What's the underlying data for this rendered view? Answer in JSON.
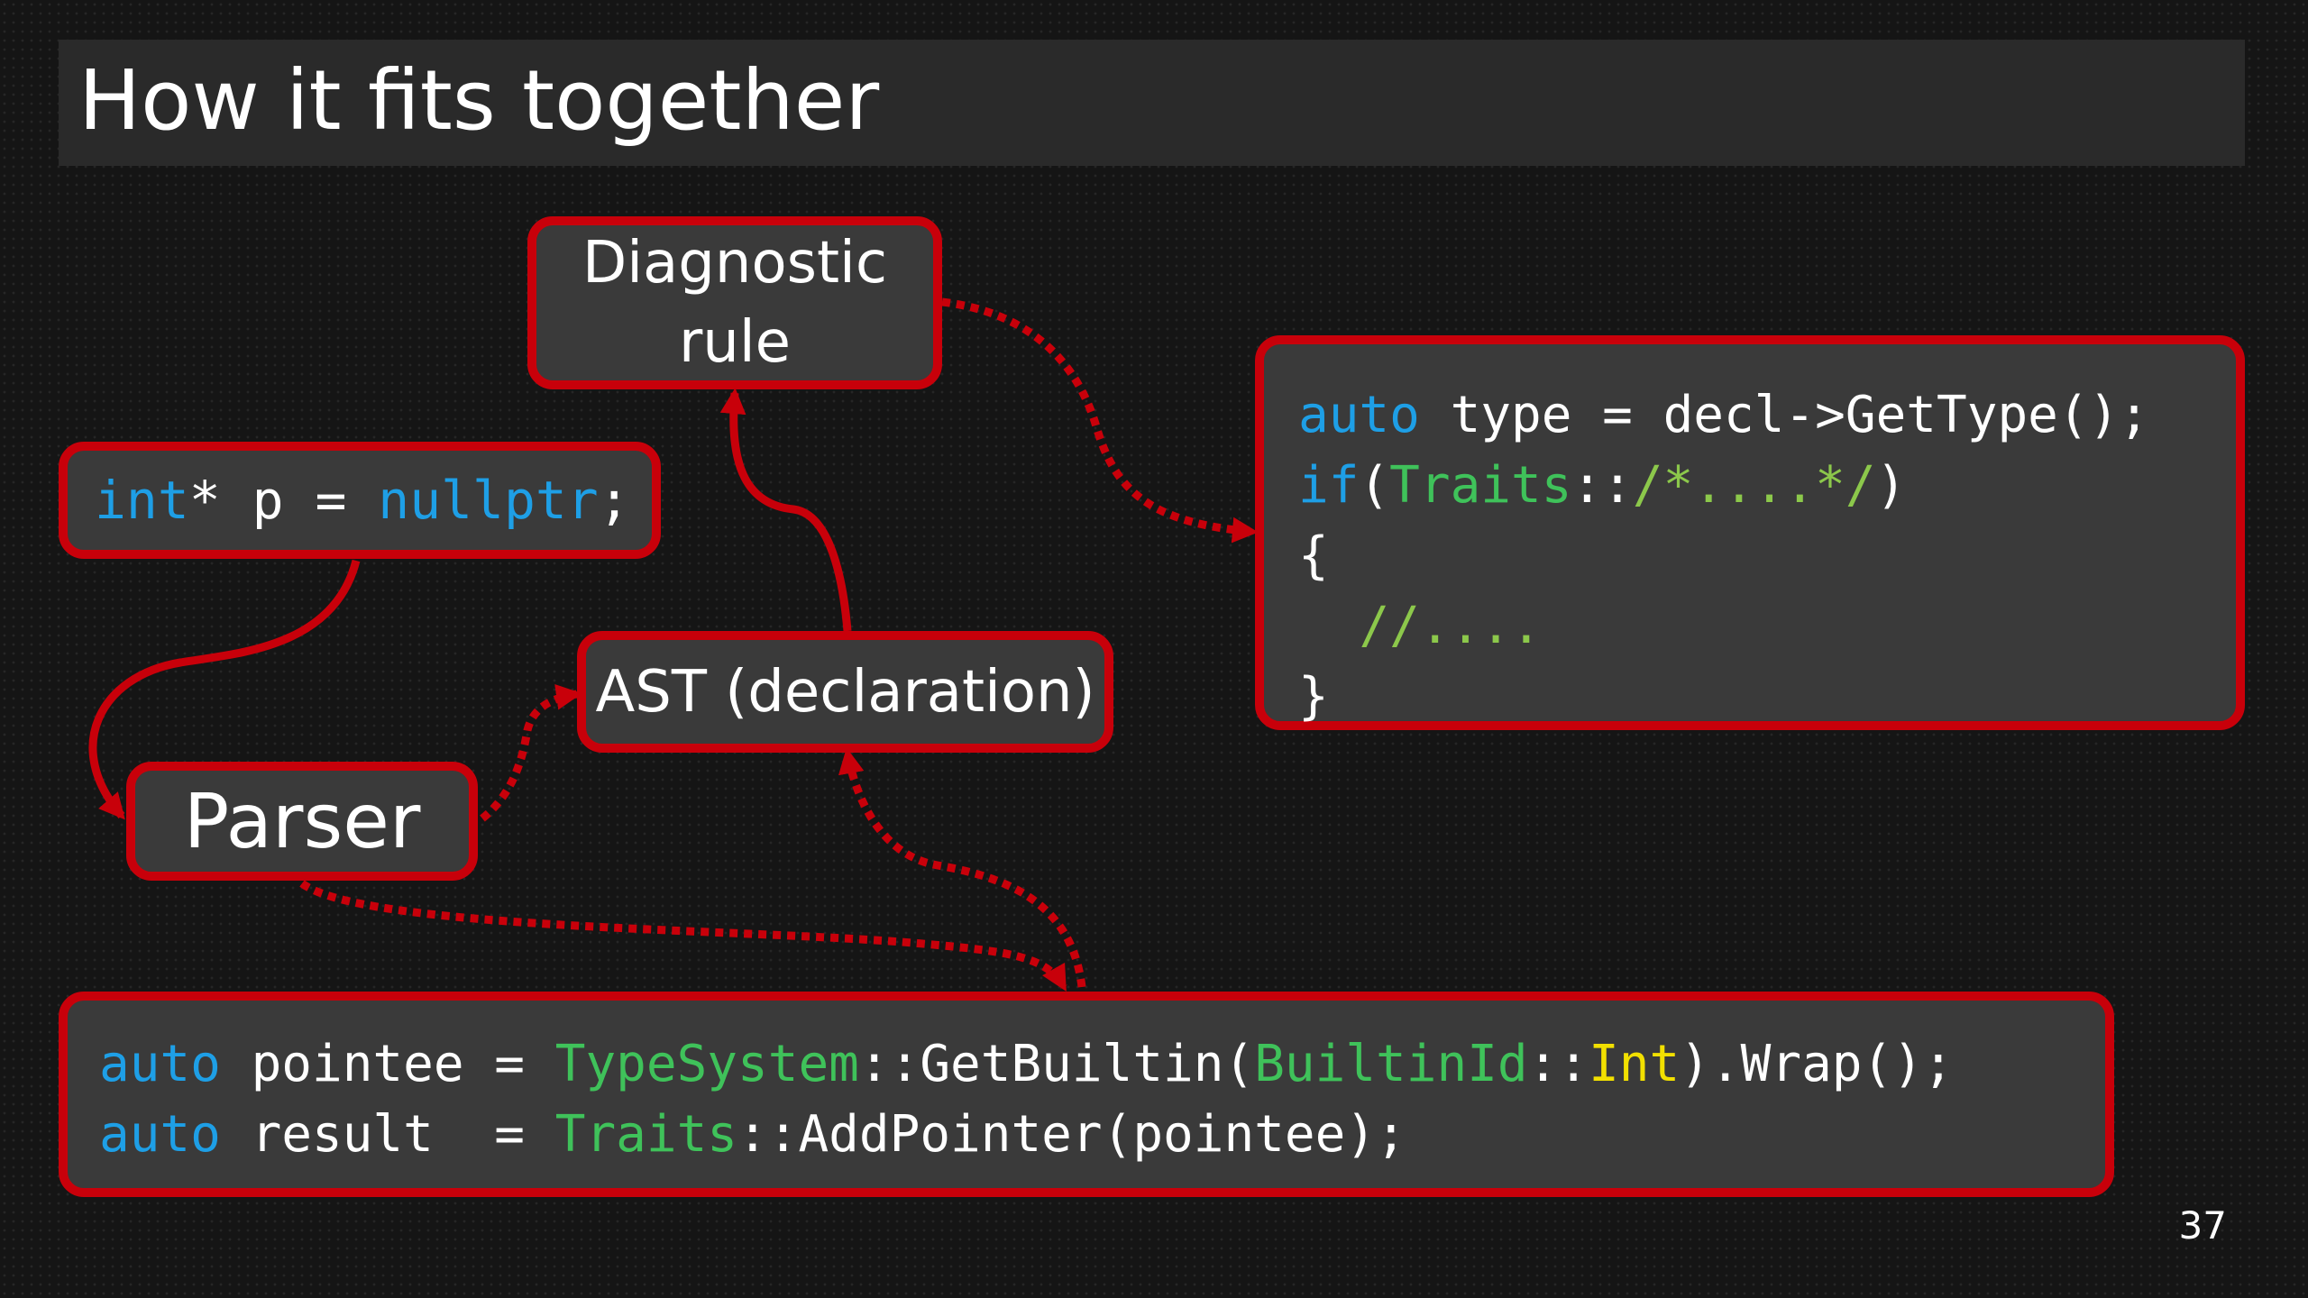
{
  "slide": {
    "title": "How it fits together",
    "page_number": "37"
  },
  "nodes": {
    "diagnostic_rule": {
      "line1": "Diagnostic",
      "line2": "rule"
    },
    "source_decl": {
      "kw1": "int",
      "rest1": "* p = ",
      "kw2": "nullptr",
      "rest2": ";"
    },
    "ast": {
      "label": "AST (declaration)"
    },
    "parser": {
      "label": "Parser"
    },
    "rule_code": {
      "l1_kw": "auto",
      "l1_rest": " type = decl->GetType();",
      "l2_kw": "if",
      "l2_p1": "(",
      "l2_ty": "Traits",
      "l2_p2": "::",
      "l2_cm": "/*....*/",
      "l2_p3": ")",
      "l3": "{",
      "l4_indent": "  ",
      "l4_cm": "//....",
      "l5": "}"
    },
    "typesystem_code": {
      "l1_kw": "auto",
      "l1_a": " pointee = ",
      "l1_ty1": "TypeSystem",
      "l1_b": "::GetBuiltin(",
      "l1_ty2": "BuiltinId",
      "l1_c": "::",
      "l1_en": "Int",
      "l1_d": ").Wrap();",
      "l2_kw": "auto",
      "l2_a": " result  = ",
      "l2_ty": "Traits",
      "l2_b": "::AddPointer(pointee);"
    }
  },
  "colors": {
    "accent_red": "#c8000a",
    "box_fill": "#3a3a3a",
    "keyword_blue": "#1e9fe6",
    "type_green": "#3fc25a",
    "comment_green": "#8cc84b",
    "enum_yellow": "#f2e000"
  }
}
